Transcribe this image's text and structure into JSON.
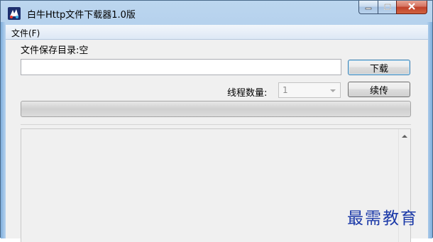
{
  "window": {
    "title": "白牛Http文件下载器1.0版",
    "app_icon": "app-logo-icon",
    "caption_buttons": [
      "minimize-icon",
      "maximize-icon",
      "close-icon"
    ]
  },
  "menu": {
    "items": [
      {
        "label": "文件(F)"
      }
    ]
  },
  "form": {
    "save_dir_label": "文件保存目录:空",
    "url_value": "",
    "download_label": "下载",
    "thread_label": "线程数量:",
    "thread_value": "1",
    "resume_label": "续传"
  },
  "progress": {
    "value": 0
  },
  "log": {
    "text": ""
  },
  "watermark": "最需教育",
  "colors": {
    "frame": "#a8c8e8",
    "close_button": "#c0412b",
    "client_bg": "#f0f0f0",
    "watermark": "#1c3aa8"
  }
}
